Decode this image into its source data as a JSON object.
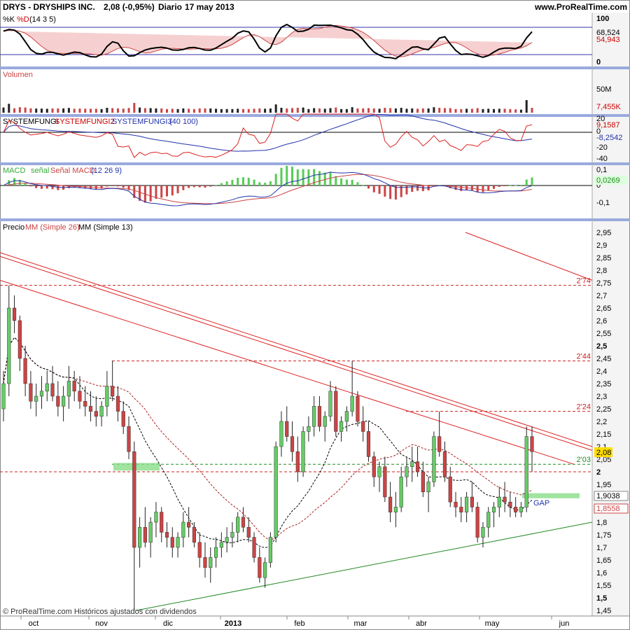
{
  "header": {
    "ticker": "DRYS - DRYSHIPS INC.",
    "quote": "2,08 (-0,95%)",
    "period": "Diario",
    "date": "17 may 2013",
    "site": "www.ProRealTime.com"
  },
  "footer": "© ProRealTime.com Históricos ajustados con dividendos",
  "colors": {
    "up": "#66cc66",
    "down": "#cc4444",
    "panel_sep": "#99aadd",
    "trend_red": "#dd2222",
    "trend_green": "#228822",
    "price_badge": "#ffdd00"
  },
  "panels": {
    "stoch": {
      "title_k": "%K",
      "title_d": "%D",
      "params": "(14 3 5)",
      "ticks": [
        "100",
        "0"
      ],
      "badges": [
        "68,524",
        "54,943"
      ]
    },
    "volume": {
      "title": "Volumen",
      "ticks": [
        "50M"
      ],
      "badge": "7,455K"
    },
    "systemfungi": {
      "title_1": "SYSTEMFUNGI",
      "title_2": "SYSTEMFUNGI2",
      "title_3": "SYSTEMFUNGI3",
      "params": "(40 100)",
      "ticks": [
        "20",
        "0",
        "-20",
        "-40"
      ],
      "badges": [
        "9,1587",
        "-8,2542"
      ]
    },
    "macd": {
      "title_1": "MACD",
      "title_2": "señal",
      "title_3": "Señal MACD",
      "params": "(12 26 9)",
      "ticks": [
        "0,1",
        "0",
        "-0,1"
      ],
      "badge": "0,0269"
    },
    "price": {
      "title_1": "Precio",
      "title_2": "MM (Simple 26)",
      "title_3": "MM (Simple 13)",
      "badges": [
        "2,08",
        "1,9038",
        "1,8558"
      ],
      "annotation_gap": "GAP"
    }
  },
  "chart_data": {
    "type": "candlestick",
    "x_labels": [
      "oct",
      "nov",
      "dic",
      "2013",
      "feb",
      "mar",
      "abr",
      "may",
      "jun"
    ],
    "y_ticks": [
      "2,95",
      "2,9",
      "2,85",
      "2,8",
      "2,75",
      "2,7",
      "2,65",
      "2,6",
      "2,55",
      "2,5",
      "2,45",
      "2,4",
      "2,35",
      "2,3",
      "2,25",
      "2,2",
      "2,15",
      "2,1",
      "2,05",
      "2",
      "1,95",
      "1,9",
      "1,85",
      "1,8",
      "1,75",
      "1,7",
      "1,65",
      "1,6",
      "1,55",
      "1,5",
      "1,45"
    ],
    "ylim": [
      1.45,
      2.95
    ],
    "level_labels": [
      "2'74",
      "2'44",
      "2'24",
      "2'03"
    ],
    "levels": [
      2.74,
      2.44,
      2.24,
      2.03
    ],
    "last": {
      "close": 2.08,
      "change": "-0,95%",
      "ma26": 1.9038,
      "ma13": 1.8558
    },
    "ohlc": [
      [
        2.25,
        2.4,
        2.2,
        2.35
      ],
      [
        2.35,
        2.74,
        2.3,
        2.65
      ],
      [
        2.65,
        2.7,
        2.55,
        2.6
      ],
      [
        2.6,
        2.62,
        2.4,
        2.45
      ],
      [
        2.45,
        2.5,
        2.3,
        2.35
      ],
      [
        2.35,
        2.4,
        2.25,
        2.28
      ],
      [
        2.28,
        2.35,
        2.22,
        2.3
      ],
      [
        2.3,
        2.38,
        2.25,
        2.32
      ],
      [
        2.32,
        2.4,
        2.28,
        2.35
      ],
      [
        2.35,
        2.42,
        2.28,
        2.3
      ],
      [
        2.3,
        2.36,
        2.22,
        2.26
      ],
      [
        2.26,
        2.34,
        2.2,
        2.3
      ],
      [
        2.3,
        2.42,
        2.25,
        2.36
      ],
      [
        2.36,
        2.4,
        2.28,
        2.32
      ],
      [
        2.32,
        2.38,
        2.25,
        2.28
      ],
      [
        2.28,
        2.34,
        2.22,
        2.26
      ],
      [
        2.26,
        2.32,
        2.2,
        2.24
      ],
      [
        2.24,
        2.3,
        2.18,
        2.22
      ],
      [
        2.22,
        2.28,
        2.18,
        2.26
      ],
      [
        2.26,
        2.4,
        2.22,
        2.34
      ],
      [
        2.34,
        2.44,
        2.28,
        2.3
      ],
      [
        2.3,
        2.34,
        2.2,
        2.24
      ],
      [
        2.24,
        2.28,
        2.15,
        2.18
      ],
      [
        2.18,
        2.22,
        2.05,
        2.08
      ],
      [
        2.08,
        2.12,
        1.45,
        1.7
      ],
      [
        1.7,
        1.82,
        1.62,
        1.78
      ],
      [
        1.78,
        1.86,
        1.7,
        1.72
      ],
      [
        1.72,
        1.82,
        1.66,
        1.8
      ],
      [
        1.8,
        1.88,
        1.74,
        1.84
      ],
      [
        1.84,
        1.86,
        1.72,
        1.76
      ],
      [
        1.76,
        1.8,
        1.7,
        1.74
      ],
      [
        1.74,
        1.78,
        1.66,
        1.7
      ],
      [
        1.7,
        1.76,
        1.66,
        1.74
      ],
      [
        1.74,
        1.84,
        1.7,
        1.8
      ],
      [
        1.8,
        1.86,
        1.74,
        1.78
      ],
      [
        1.78,
        1.8,
        1.7,
        1.72
      ],
      [
        1.72,
        1.76,
        1.62,
        1.66
      ],
      [
        1.66,
        1.72,
        1.58,
        1.62
      ],
      [
        1.62,
        1.7,
        1.56,
        1.66
      ],
      [
        1.66,
        1.74,
        1.62,
        1.7
      ],
      [
        1.7,
        1.76,
        1.66,
        1.72
      ],
      [
        1.72,
        1.78,
        1.68,
        1.74
      ],
      [
        1.74,
        1.8,
        1.7,
        1.76
      ],
      [
        1.76,
        1.84,
        1.72,
        1.82
      ],
      [
        1.82,
        1.86,
        1.76,
        1.78
      ],
      [
        1.78,
        1.82,
        1.72,
        1.74
      ],
      [
        1.74,
        1.76,
        1.64,
        1.66
      ],
      [
        1.66,
        1.7,
        1.56,
        1.58
      ],
      [
        1.58,
        1.66,
        1.54,
        1.64
      ],
      [
        1.64,
        1.76,
        1.62,
        1.74
      ],
      [
        1.74,
        2.12,
        1.72,
        2.1
      ],
      [
        2.1,
        2.24,
        2.06,
        2.2
      ],
      [
        2.2,
        2.26,
        2.12,
        2.14
      ],
      [
        2.14,
        2.2,
        2.04,
        2.08
      ],
      [
        2.08,
        2.14,
        1.96,
        2.0
      ],
      [
        2.0,
        2.18,
        1.98,
        2.16
      ],
      [
        2.16,
        2.22,
        2.12,
        2.18
      ],
      [
        2.18,
        2.3,
        2.14,
        2.26
      ],
      [
        2.26,
        2.3,
        2.16,
        2.18
      ],
      [
        2.18,
        2.24,
        2.12,
        2.22
      ],
      [
        2.22,
        2.36,
        2.2,
        2.32
      ],
      [
        2.32,
        2.34,
        2.14,
        2.16
      ],
      [
        2.16,
        2.22,
        2.12,
        2.2
      ],
      [
        2.2,
        2.26,
        2.16,
        2.24
      ],
      [
        2.24,
        2.44,
        2.22,
        2.3
      ],
      [
        2.3,
        2.32,
        2.18,
        2.2
      ],
      [
        2.2,
        2.26,
        2.12,
        2.16
      ],
      [
        2.16,
        2.2,
        2.04,
        2.06
      ],
      [
        2.06,
        2.08,
        1.94,
        1.98
      ],
      [
        1.98,
        2.04,
        1.92,
        2.02
      ],
      [
        2.02,
        2.06,
        1.88,
        1.9
      ],
      [
        1.9,
        1.96,
        1.8,
        1.84
      ],
      [
        1.84,
        1.92,
        1.78,
        1.86
      ],
      [
        1.86,
        2.02,
        1.84,
        1.98
      ],
      [
        1.98,
        2.06,
        1.94,
        2.02
      ],
      [
        2.02,
        2.1,
        1.96,
        2.04
      ],
      [
        2.04,
        2.1,
        1.98,
        2.0
      ],
      [
        2.0,
        2.04,
        1.9,
        1.92
      ],
      [
        1.92,
        1.98,
        1.84,
        1.96
      ],
      [
        1.96,
        2.16,
        1.94,
        2.14
      ],
      [
        2.14,
        2.24,
        2.06,
        2.08
      ],
      [
        2.08,
        2.12,
        1.96,
        1.98
      ],
      [
        1.98,
        2.02,
        1.86,
        1.88
      ],
      [
        1.88,
        1.92,
        1.82,
        1.86
      ],
      [
        1.86,
        1.9,
        1.8,
        1.84
      ],
      [
        1.84,
        1.92,
        1.8,
        1.9
      ],
      [
        1.9,
        1.96,
        1.84,
        1.86
      ],
      [
        1.86,
        1.88,
        1.72,
        1.74
      ],
      [
        1.74,
        1.8,
        1.7,
        1.78
      ],
      [
        1.78,
        1.86,
        1.74,
        1.84
      ],
      [
        1.84,
        1.88,
        1.78,
        1.86
      ],
      [
        1.86,
        1.94,
        1.82,
        1.9
      ],
      [
        1.9,
        1.96,
        1.84,
        1.88
      ],
      [
        1.88,
        1.92,
        1.82,
        1.86
      ],
      [
        1.86,
        1.9,
        1.82,
        1.84
      ],
      [
        1.84,
        1.88,
        1.82,
        1.86
      ],
      [
        1.86,
        2.18,
        1.84,
        2.14
      ],
      [
        2.14,
        2.18,
        2.0,
        2.08
      ]
    ]
  }
}
